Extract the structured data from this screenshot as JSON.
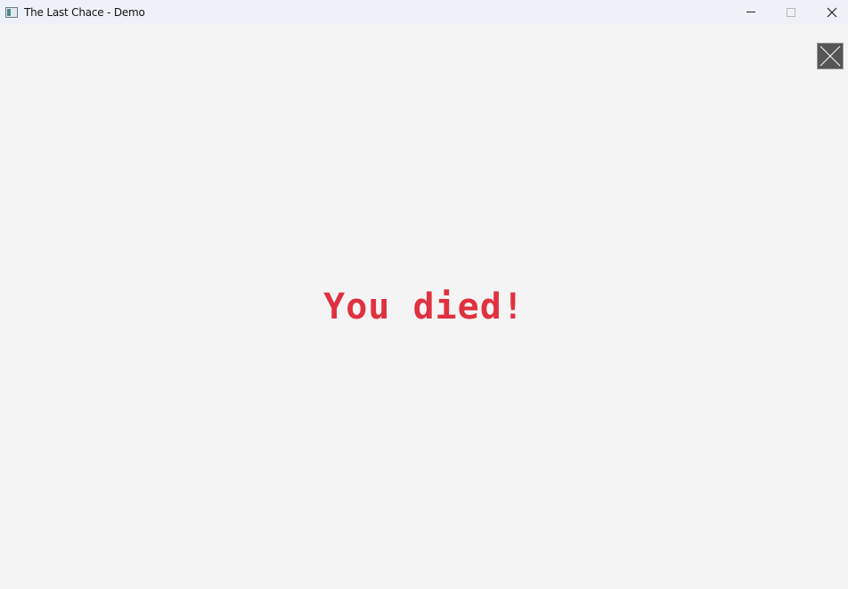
{
  "window": {
    "title": "The Last Chace - Demo",
    "icons": {
      "app": "app-icon",
      "minimize": "minimize-icon",
      "maximize": "maximize-icon",
      "close": "close-icon"
    }
  },
  "game": {
    "message": "You died!",
    "message_color": "#e03140",
    "background_color": "#f4f4f4",
    "quit_button_icon": "x-icon",
    "quit_button_color": "#555555"
  }
}
